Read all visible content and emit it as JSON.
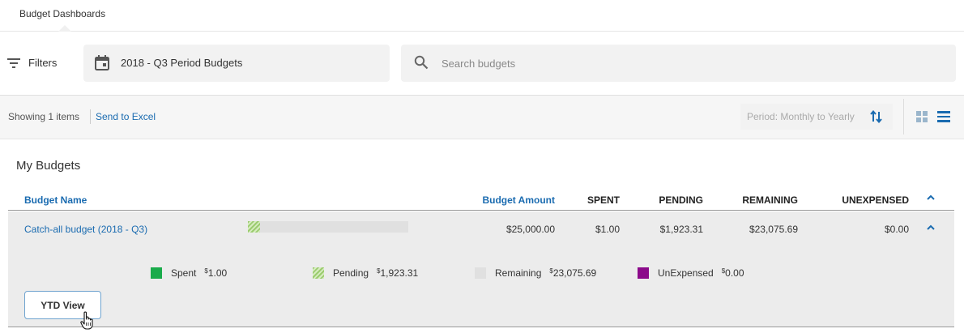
{
  "tabs": {
    "active_label": "Budget Dashboards"
  },
  "filterbar": {
    "filters_label": "Filters",
    "period_value": "2018 - Q3 Period Budgets",
    "search_placeholder": "Search budgets"
  },
  "toolbar": {
    "showing_text": "Showing 1 items",
    "send_excel_label": "Send to Excel",
    "period_label": "Period: Monthly to Yearly"
  },
  "section": {
    "title": "My Budgets"
  },
  "table": {
    "headers": {
      "name": "Budget Name",
      "amount": "Budget Amount",
      "spent": "SPENT",
      "pending": "PENDING",
      "remaining": "REMAINING",
      "unexpensed": "UNEXPENSED"
    },
    "rows": [
      {
        "name": "Catch-all budget",
        "period": "(2018 - Q3)",
        "amount": "$25,000.00",
        "spent": "$1.00",
        "pending": "$1,923.31",
        "remaining": "$23,075.69",
        "unexpensed": "$0.00",
        "pending_fraction": 0.077
      }
    ]
  },
  "legend": [
    {
      "label": "Spent",
      "currency": "$",
      "amount": "1.00",
      "color": "#1aab4b"
    },
    {
      "label": "Pending",
      "currency": "$",
      "amount": "1,923.31",
      "color": "#9ccc70"
    },
    {
      "label": "Remaining",
      "currency": "$",
      "amount": "23,075.69",
      "color": "#e0e0e0"
    },
    {
      "label": "UnExpensed",
      "currency": "$",
      "amount": "0.00",
      "color": "#8b0a8a"
    }
  ],
  "ytd_button": {
    "label": "YTD View"
  },
  "colors": {
    "link": "#1a6bb0",
    "row_bg": "#ececec",
    "filter_bg": "#f2f2f2"
  },
  "icons": [
    "filter-icon",
    "calendar-icon",
    "search-icon",
    "sort-icon",
    "grid-view-icon",
    "list-view-icon",
    "chevron-up-icon",
    "hand-cursor-icon"
  ]
}
